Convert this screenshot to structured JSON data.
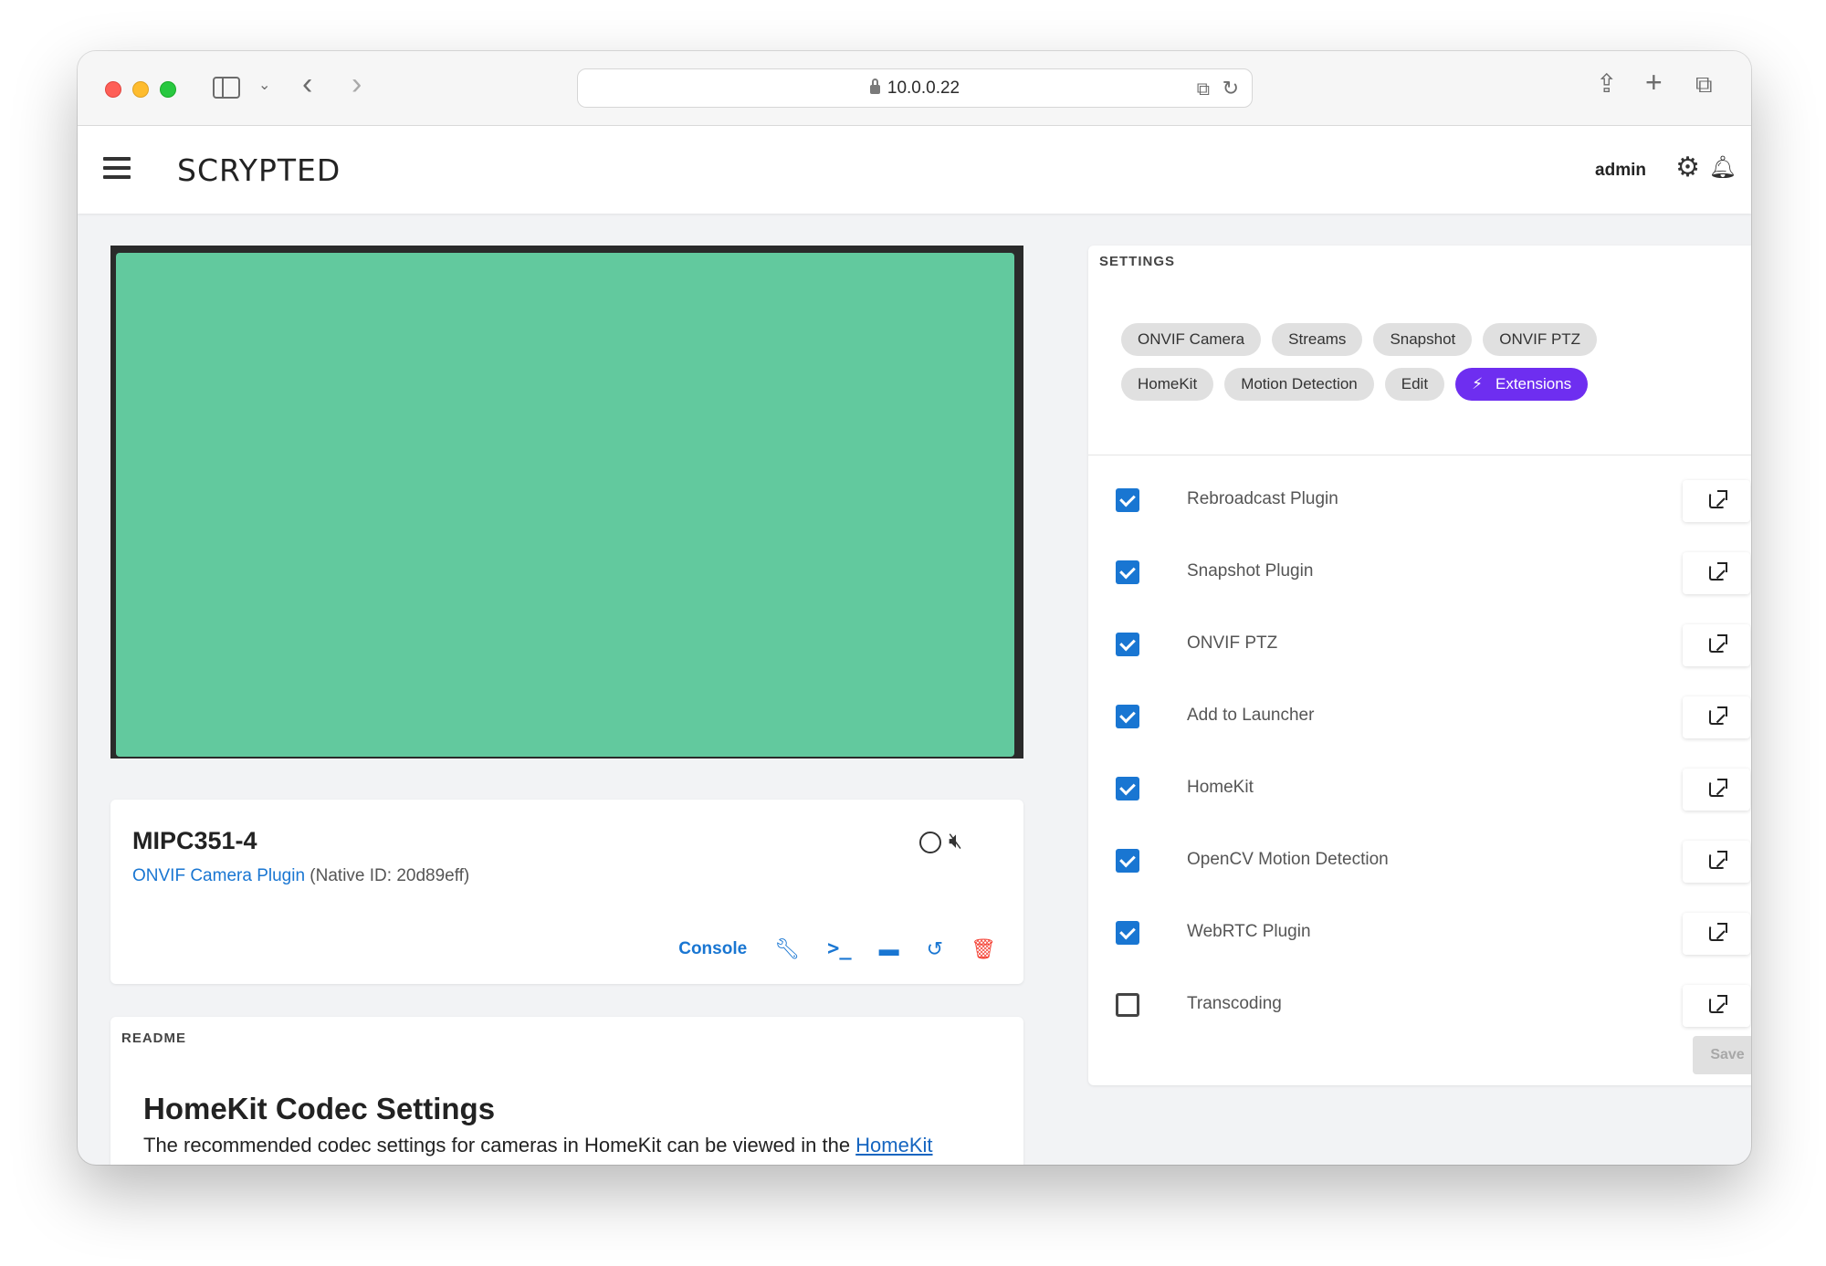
{
  "browser": {
    "url": "10.0.0.22"
  },
  "header": {
    "brand": "SCRYPTED",
    "user": "admin"
  },
  "device": {
    "name": "MIPC351-4",
    "plugin_link": "ONVIF Camera Plugin",
    "native_id": "(Native ID: 20d89eff)",
    "console_label": "Console"
  },
  "readme": {
    "label": "README",
    "title": "HomeKit Codec Settings",
    "text": "The recommended codec settings for cameras in HomeKit can be viewed in the ",
    "link": "HomeKit"
  },
  "settings": {
    "label": "SETTINGS",
    "tabs_row1": [
      "ONVIF Camera",
      "Streams",
      "Snapshot",
      "ONVIF PTZ"
    ],
    "tabs_row2": [
      "HomeKit",
      "Motion Detection",
      "Edit"
    ],
    "active_tab": "Extensions",
    "active_color": "#6e2ef0",
    "extensions": [
      {
        "label": "Rebroadcast Plugin",
        "checked": true
      },
      {
        "label": "Snapshot Plugin",
        "checked": true
      },
      {
        "label": "ONVIF PTZ",
        "checked": true
      },
      {
        "label": "Add to Launcher",
        "checked": true
      },
      {
        "label": "HomeKit",
        "checked": true
      },
      {
        "label": "OpenCV Motion Detection",
        "checked": true
      },
      {
        "label": "WebRTC Plugin",
        "checked": true
      },
      {
        "label": "Transcoding",
        "checked": false
      }
    ],
    "save_label": "Save"
  },
  "colors": {
    "accent": "#1976d2",
    "video_placeholder": "#62c99e",
    "delete": "#f44336"
  }
}
